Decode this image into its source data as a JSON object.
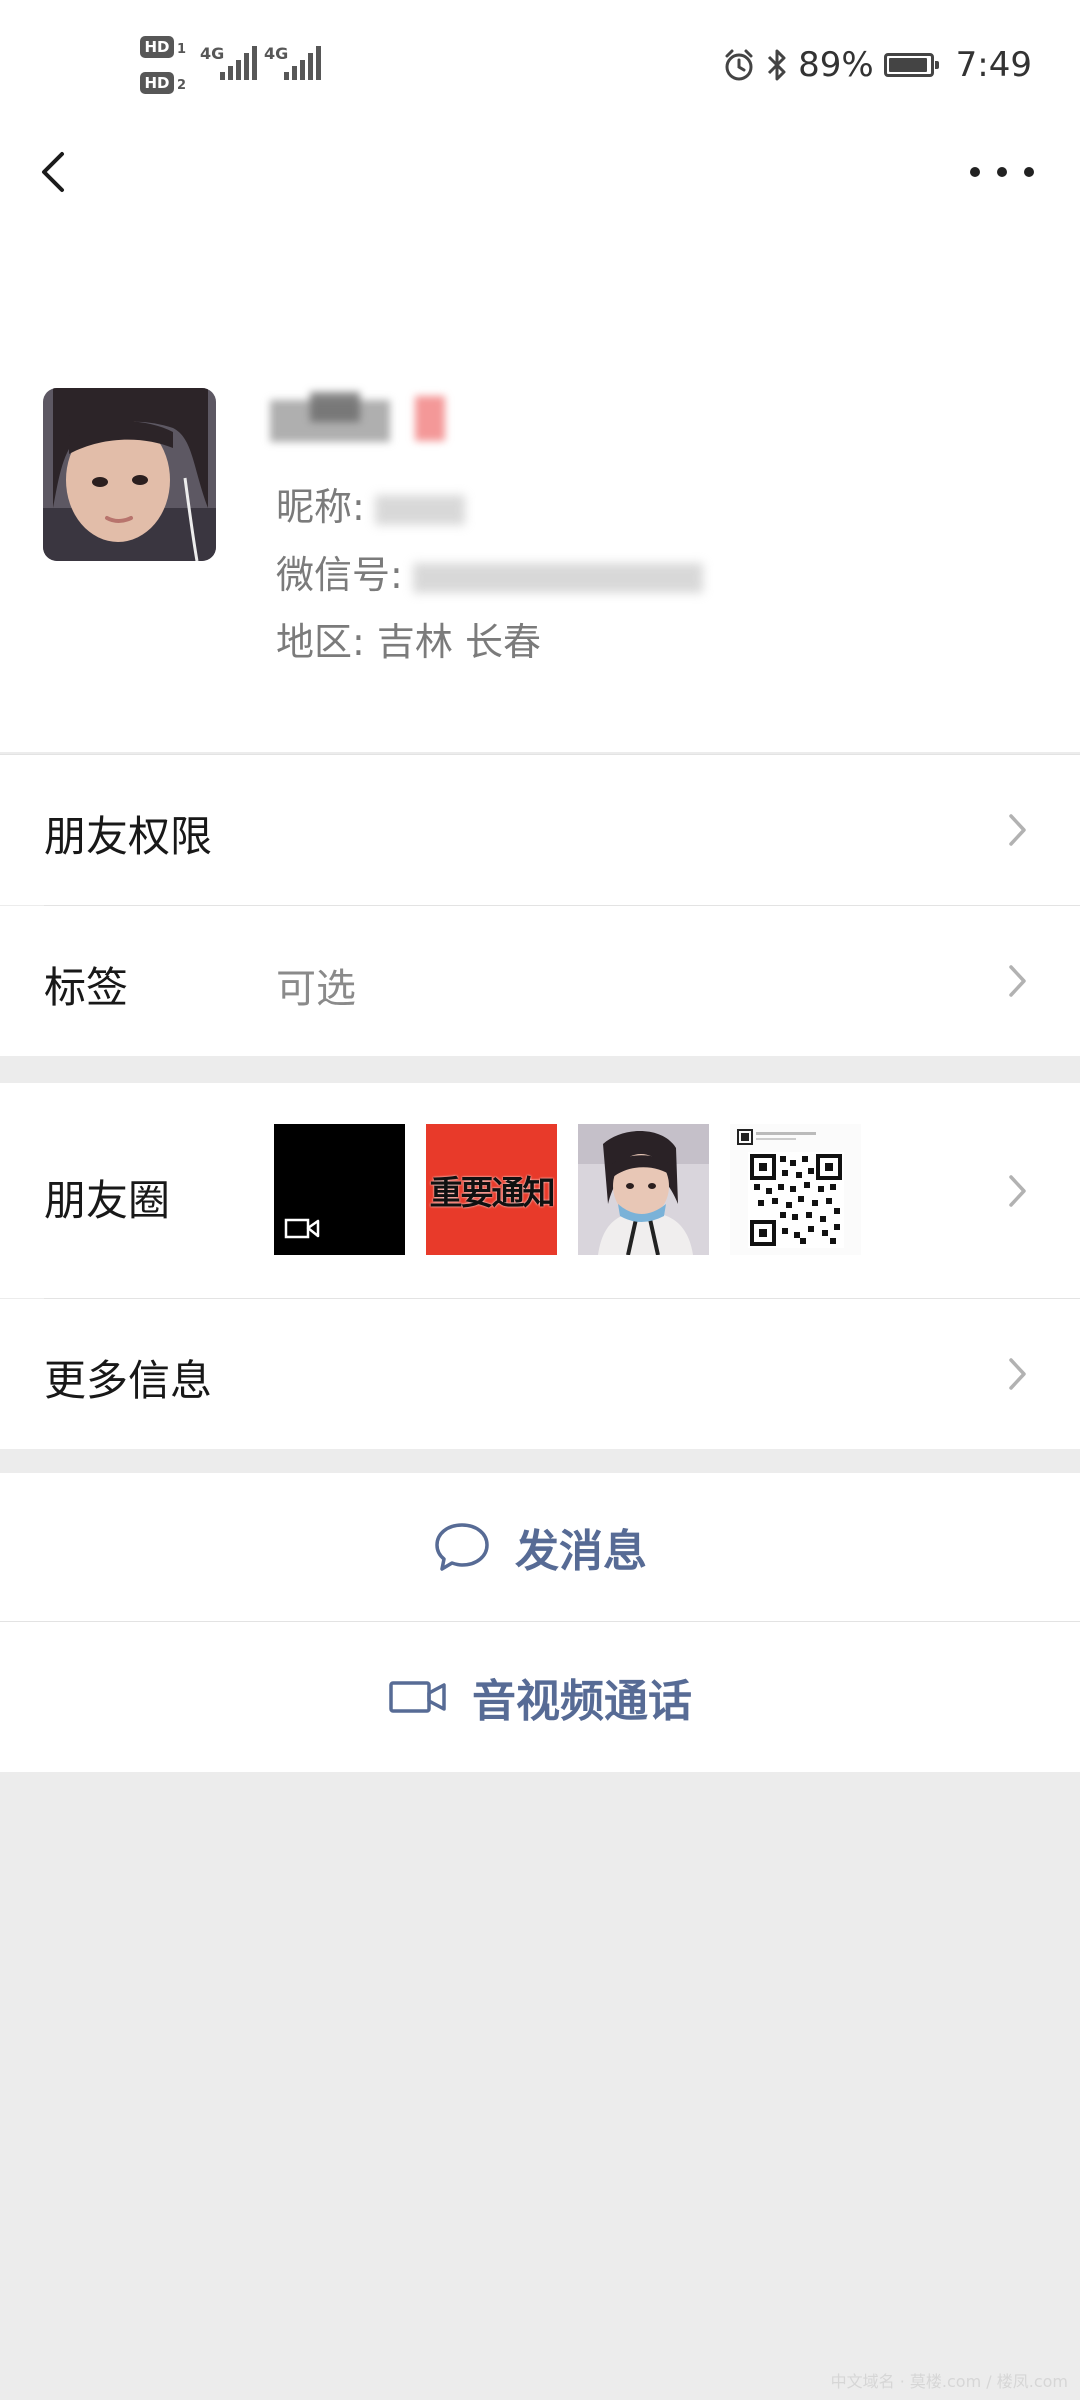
{
  "status_bar": {
    "hd_badge": "HD",
    "sim1_index": "1",
    "sim2_index": "2",
    "network1": "4G",
    "network2": "4G",
    "battery": "89%",
    "time": "7:49",
    "icons": [
      "alarm-icon",
      "bluetooth-icon",
      "battery-icon"
    ]
  },
  "nav": {
    "back_icon": "chevron-left-icon",
    "more_icon": "more-dots-icon"
  },
  "profile": {
    "nickname_label": "昵称:",
    "wechat_id_label": "微信号:",
    "region_label": "地区:",
    "region_value": "吉林  长春"
  },
  "rows": {
    "friend_permissions": "朋友权限",
    "tags_label": "标签",
    "tags_value": "可选",
    "moments": "朋友圈",
    "more_info": "更多信息"
  },
  "moments_thumbs": {
    "notice_text": "重要通知",
    "items": [
      "video-thumb",
      "notice-thumb",
      "photo-thumb",
      "qr-code-thumb"
    ]
  },
  "actions": {
    "send_message": "发消息",
    "video_call": "音视频通话"
  },
  "colors": {
    "link_blue": "#576b95",
    "page_bg": "#ececec",
    "notice_red": "#e83a2a"
  },
  "watermark": "中文域名 · 莫楼.com / 楼凤.com"
}
